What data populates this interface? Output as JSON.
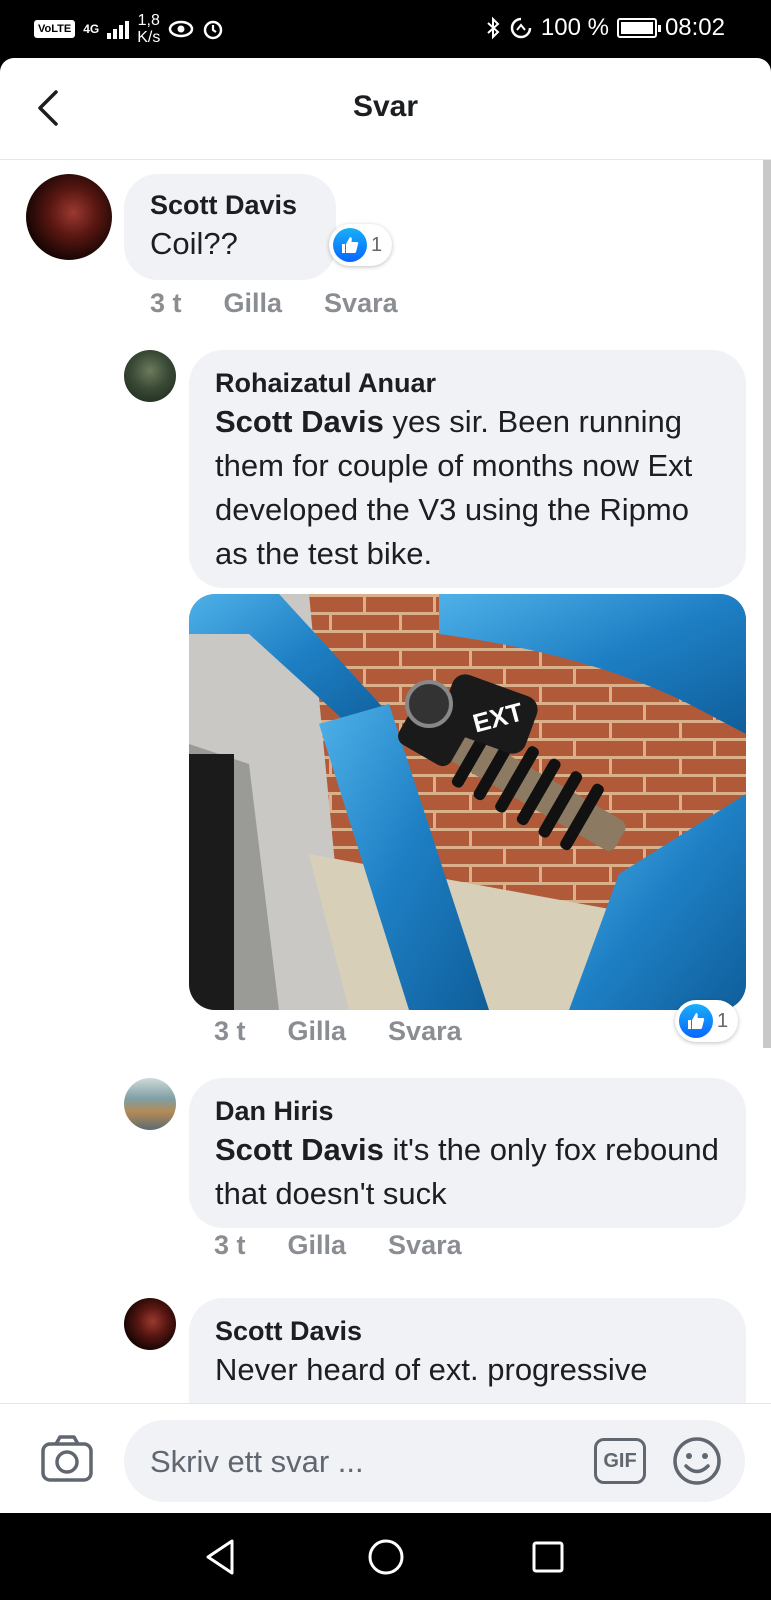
{
  "status_bar": {
    "carrier_badge": "VoLTE",
    "network": "4G",
    "speed_value": "1,8",
    "speed_unit": "K/s",
    "battery": "100 %",
    "time": "08:02"
  },
  "header": {
    "title": "Svar",
    "back_icon": "chevron-left-icon"
  },
  "comments": [
    {
      "author": "Scott Davis",
      "text": "Coil??",
      "reaction_count": "1",
      "time": "3 t",
      "like_label": "Gilla",
      "reply_label": "Svara"
    },
    {
      "author": "Rohaizatul Anuar",
      "mention": "Scott Davis",
      "text": " yes sir. Been running them for couple of months now Ext developed the V3 using the Ripmo as the test bike.",
      "reaction_count": "1",
      "time": "3 t",
      "like_label": "Gilla",
      "reply_label": "Svara",
      "photo_text": "EXT"
    },
    {
      "author": "Dan Hiris",
      "mention": "Scott Davis",
      "text": " it's the only fox rebound that doesn't suck",
      "time": "3 t",
      "like_label": "Gilla",
      "reply_label": "Svara"
    },
    {
      "author": "Scott Davis",
      "text": "Never heard of ext. progressive"
    }
  ],
  "composer": {
    "placeholder": "Skriv ett svar ...",
    "gif_label": "GIF",
    "camera_icon": "camera-icon",
    "emoji_icon": "smiley-icon"
  },
  "colors": {
    "like_blue": "#0866ff",
    "bubble_bg": "#f0f2f5",
    "muted_text": "#8a8d91"
  }
}
